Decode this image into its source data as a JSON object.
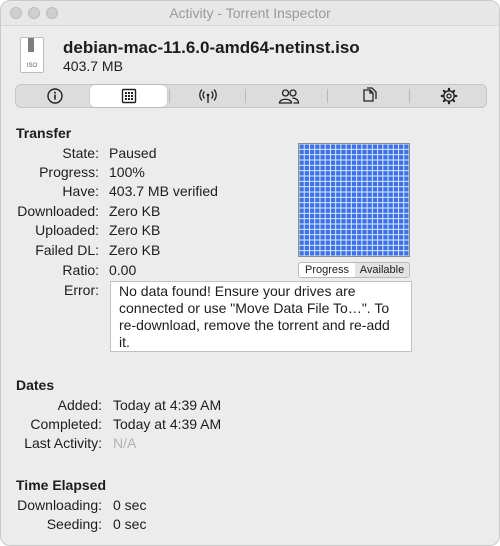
{
  "window": {
    "title": "Activity - Torrent Inspector"
  },
  "file": {
    "icon_label": "ISO",
    "name": "debian-mac-11.6.0-amd64-netinst.iso",
    "size": "403.7 MB"
  },
  "tabs": [
    {
      "icon": "info-icon",
      "selected": false
    },
    {
      "icon": "pieces-grid-icon",
      "selected": true
    },
    {
      "icon": "antenna-icon",
      "selected": false
    },
    {
      "icon": "peers-icon",
      "selected": false
    },
    {
      "icon": "files-icon",
      "selected": false
    },
    {
      "icon": "gear-icon",
      "selected": false
    }
  ],
  "transfer": {
    "heading": "Transfer",
    "rows": [
      {
        "label": "State:",
        "value": "Paused"
      },
      {
        "label": "Progress:",
        "value": "100%"
      },
      {
        "label": "Have:",
        "value": "403.7 MB verified"
      },
      {
        "label": "Downloaded:",
        "value": "Zero KB"
      },
      {
        "label": "Uploaded:",
        "value": "Zero KB"
      },
      {
        "label": "Failed DL:",
        "value": "Zero KB"
      },
      {
        "label": "Ratio:",
        "value": "0.00"
      }
    ],
    "error_label": "Error:",
    "error_text": "No data found! Ensure your drives are connected or use \"Move Data File To…\". To re-download, remove the torrent and re-add it."
  },
  "pieces": {
    "color": "#3b73e8",
    "segments": {
      "progress": "Progress",
      "available": "Available",
      "selected": "progress"
    }
  },
  "dates": {
    "heading": "Dates",
    "rows": [
      {
        "label": "Added:",
        "value": "Today at 4:39 AM"
      },
      {
        "label": "Completed:",
        "value": "Today at 4:39 AM"
      },
      {
        "label": "Last Activity:",
        "value": "N/A"
      }
    ]
  },
  "time_elapsed": {
    "heading": "Time Elapsed",
    "rows": [
      {
        "label": "Downloading:",
        "value": "0 sec"
      },
      {
        "label": "Seeding:",
        "value": "0 sec"
      }
    ]
  }
}
